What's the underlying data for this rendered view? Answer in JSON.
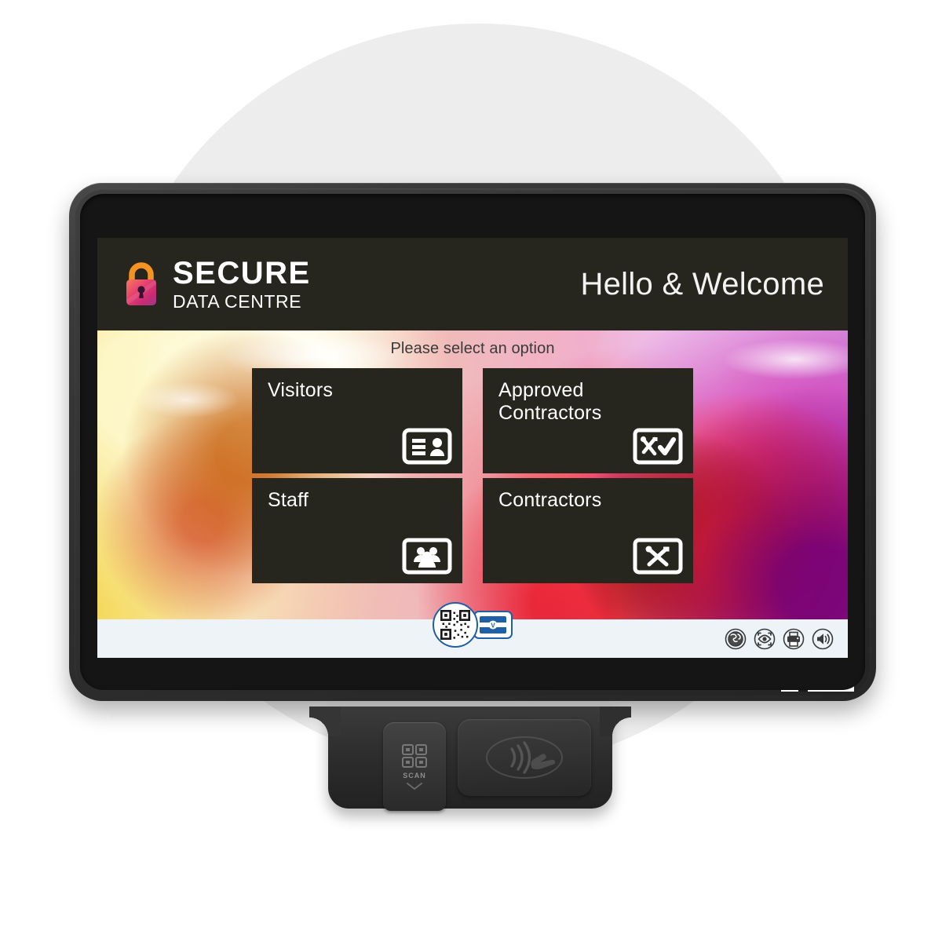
{
  "device": {
    "brand_logo": {
      "prefix": "IN",
      "middle": "V",
      "suffix": "ENTRY"
    },
    "reader": {
      "scan_label": "SCAN",
      "scan_icon": "qr-scan-icon",
      "nfc_icon": "contactless-nfc-icon"
    }
  },
  "screen": {
    "header": {
      "lock_icon": "padlock-icon",
      "brand_main": "SECURE",
      "brand_sub": "DATA CENTRE",
      "welcome": "Hello & Welcome"
    },
    "body": {
      "hint": "Please select an option",
      "tiles": [
        {
          "label": "Visitors",
          "icon": "id-card-icon"
        },
        {
          "label": "Approved\nContractors",
          "icon": "tools-check-icon"
        },
        {
          "label": "Staff",
          "icon": "people-group-icon"
        },
        {
          "label": "Contractors",
          "icon": "tools-icon"
        }
      ]
    },
    "footer": {
      "qr_icon": "qr-code-icon",
      "badge_icon": "id-badge-icon",
      "system_icons": [
        {
          "name": "globe-language-icon"
        },
        {
          "name": "eye-accessibility-icon"
        },
        {
          "name": "printer-icon"
        },
        {
          "name": "speaker-volume-icon"
        }
      ]
    }
  },
  "colors": {
    "panel_dark": "#26261f",
    "footer_bg": "#edf3f7",
    "accent_blue": "#1e5fa8",
    "lock_shackle": "#f59322",
    "lock_body_from": "#ef6a6a",
    "lock_body_to": "#c2256c",
    "backdrop": "#ededed"
  }
}
